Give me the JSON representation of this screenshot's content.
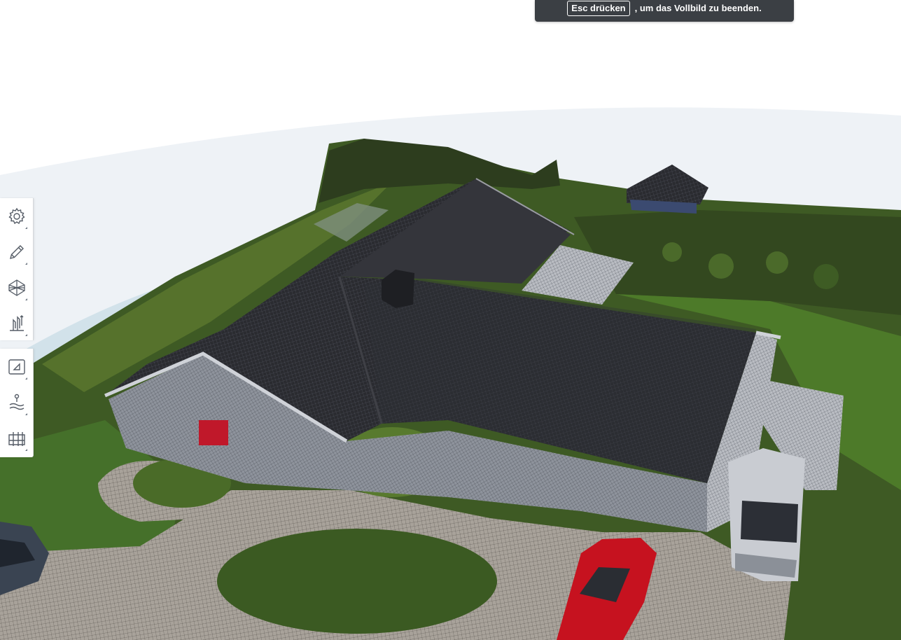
{
  "fullscreen_notice": {
    "key_label": "Esc drücken",
    "message": ", um das Vollbild zu beenden."
  },
  "toolbar_primary": {
    "tools": [
      {
        "icon": "settings-gear-icon",
        "has_submenu": true
      },
      {
        "icon": "pencil-icon",
        "has_submenu": true
      },
      {
        "icon": "mesh-view-icon",
        "has_submenu": true
      },
      {
        "icon": "measure-height-icon",
        "has_submenu": true
      }
    ]
  },
  "toolbar_secondary": {
    "tools": [
      {
        "icon": "area-measure-icon",
        "has_submenu": true
      },
      {
        "icon": "point-marker-icon",
        "has_submenu": true
      },
      {
        "icon": "cross-section-icon",
        "has_submenu": true
      }
    ]
  },
  "colors": {
    "banner_background": "#3b3f44",
    "toolbar_icon": "#555c66",
    "sky": "#eef2f6"
  }
}
